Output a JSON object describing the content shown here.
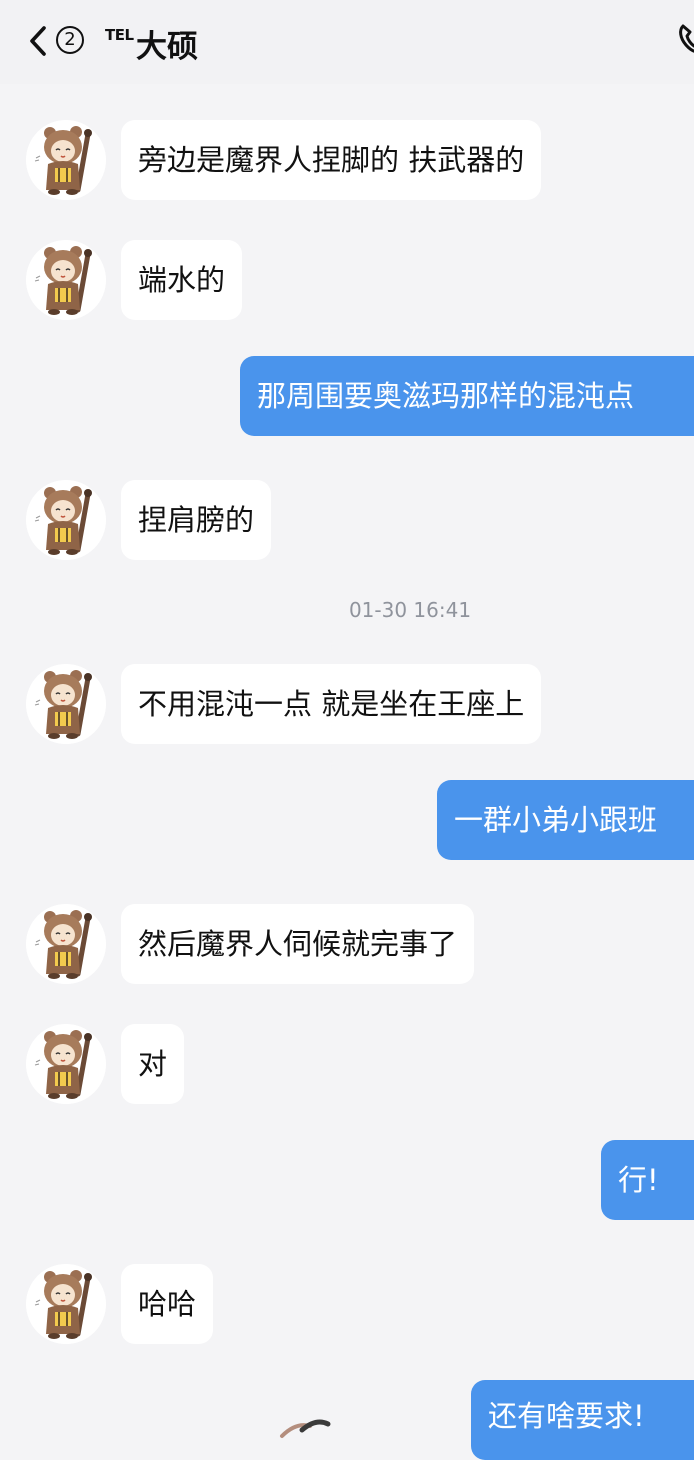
{
  "header": {
    "back_label": "back",
    "unread_count": "2",
    "tel_tag": "TEL",
    "contact_name": "大硕"
  },
  "messages": [
    {
      "side": "in",
      "text": "旁边是魔界人捏脚的 扶武器的"
    },
    {
      "side": "in",
      "text": "端水的"
    },
    {
      "side": "out",
      "text": "那周围要奥滋玛那样的混沌点"
    },
    {
      "side": "in",
      "text": "捏肩膀的"
    },
    {
      "side": "time",
      "text": "01-30 16:41"
    },
    {
      "side": "in",
      "text": "不用混沌一点 就是坐在王座上"
    },
    {
      "side": "out",
      "text": "一群小弟小跟班"
    },
    {
      "side": "in",
      "text": "然后魔界人伺候就完事了"
    },
    {
      "side": "in",
      "text": " 对"
    },
    {
      "side": "out",
      "text": "行!"
    },
    {
      "side": "in",
      "text": "哈哈"
    },
    {
      "side": "out",
      "text": "还有啥要求!"
    }
  ],
  "colors": {
    "background": "#f4f4f6",
    "outgoing_bubble": "#4a94ec",
    "incoming_bubble": "#ffffff",
    "timestamp_text": "#8f939c"
  },
  "icons": {
    "back": "chevron-left-icon",
    "phone": "phone-icon",
    "avatar": "bear-costume-avatar"
  }
}
